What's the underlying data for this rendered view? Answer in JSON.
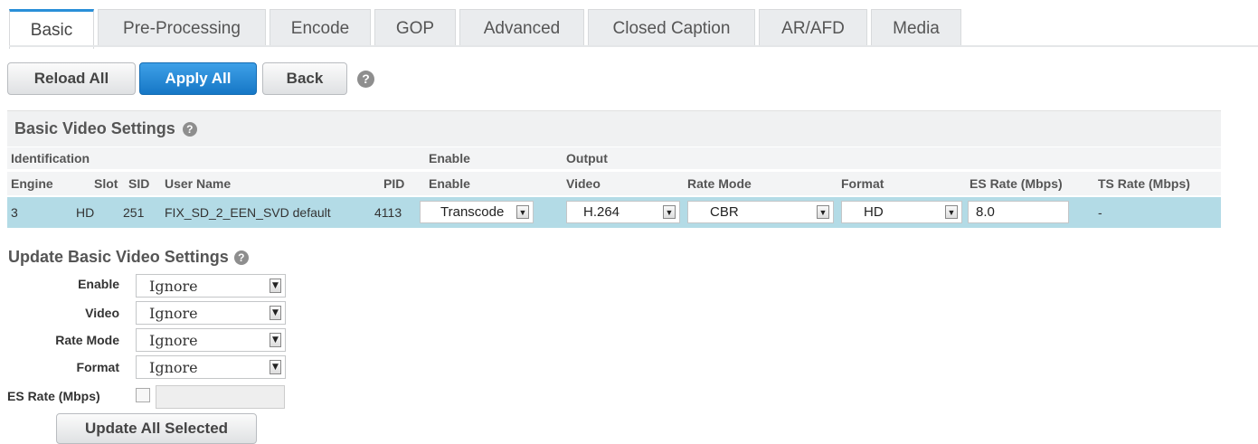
{
  "tabs": [
    {
      "label": "Basic",
      "active": true
    },
    {
      "label": "Pre-Processing"
    },
    {
      "label": "Encode"
    },
    {
      "label": "GOP"
    },
    {
      "label": "Advanced"
    },
    {
      "label": "Closed Caption"
    },
    {
      "label": "AR/AFD"
    },
    {
      "label": "Media"
    }
  ],
  "toolbar": {
    "reload_label": "Reload All",
    "apply_label": "Apply All",
    "back_label": "Back",
    "help_glyph": "?"
  },
  "basic_video": {
    "title": "Basic Video Settings",
    "groups": {
      "identification": "Identification",
      "enable": "Enable",
      "output": "Output"
    },
    "columns": {
      "engine": "Engine",
      "slot": "Slot",
      "sid": "SID",
      "user_name": "User Name",
      "pid": "PID",
      "enable": "Enable",
      "video": "Video",
      "rate_mode": "Rate Mode",
      "format": "Format",
      "es_rate": "ES Rate (Mbps)",
      "ts_rate": "TS Rate (Mbps)"
    },
    "row": {
      "engine": "3",
      "slot": "HD",
      "sid": "251",
      "user_name": "FIX_SD_2_EEN_SVD default",
      "pid": "4113",
      "enable": "Transcode",
      "video": "H.264",
      "rate_mode": "CBR",
      "format": "HD",
      "es_rate": "8.0",
      "ts_rate": "-"
    }
  },
  "update": {
    "title": "Update Basic Video Settings",
    "enable_label": "Enable",
    "enable_value": "Ignore",
    "video_label": "Video",
    "video_value": "Ignore",
    "rate_mode_label": "Rate Mode",
    "rate_mode_value": "Ignore",
    "format_label": "Format",
    "format_value": "Ignore",
    "es_rate_label": "ES Rate (Mbps)",
    "update_button": "Update All Selected"
  },
  "colors": {
    "accent": "#2a8fd8",
    "row_highlight": "#b3dbe6",
    "apply_button": "#1677c6"
  },
  "icons": {
    "help": "help-circle-icon",
    "dropdown": "dropdown-arrow-icon"
  }
}
